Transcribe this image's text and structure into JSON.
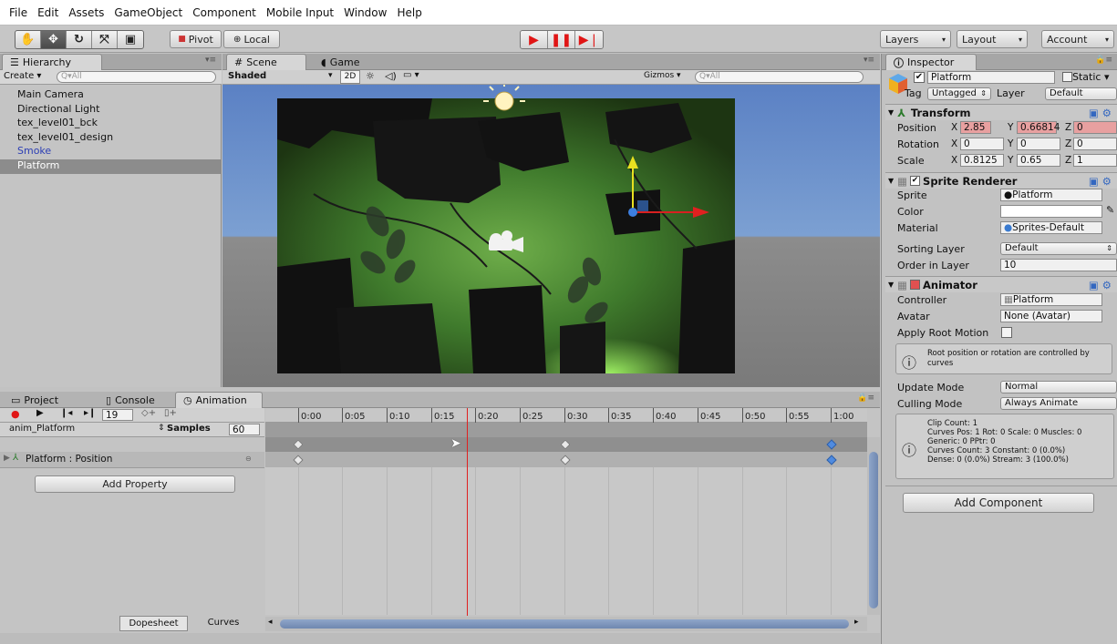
{
  "menu": [
    "File",
    "Edit",
    "Assets",
    "GameObject",
    "Component",
    "Mobile Input",
    "Window",
    "Help"
  ],
  "toolbar": {
    "tools": [
      "hand-icon",
      "move-icon",
      "rotate-icon",
      "scale-icon",
      "rect-icon"
    ],
    "pivot_label": "Pivot",
    "local_label": "Local",
    "layers_label": "Layers",
    "layout_label": "Layout",
    "account_label": "Account"
  },
  "hierarchy": {
    "tab": "Hierarchy",
    "create_label": "Create",
    "search_placeholder": "Q▾All",
    "items": [
      {
        "label": "Main Camera"
      },
      {
        "label": "Directional Light"
      },
      {
        "label": "tex_level01_bck"
      },
      {
        "label": "tex_level01_design"
      },
      {
        "label": "Smoke"
      },
      {
        "label": "Platform"
      }
    ]
  },
  "scene": {
    "tab_scene": "Scene",
    "tab_game": "Game",
    "shading": "Shaded",
    "mode_2d": "2D",
    "gizmos": "Gizmos",
    "search_placeholder": "Q▾All"
  },
  "inspector": {
    "tab": "Inspector",
    "object_name": "Platform",
    "static_label": "Static",
    "tag_label": "Tag",
    "tag_value": "Untagged",
    "layer_label": "Layer",
    "layer_value": "Default",
    "transform": {
      "title": "Transform",
      "position_label": "Position",
      "rotation_label": "Rotation",
      "scale_label": "Scale",
      "position": {
        "x": "2.85",
        "y": "0.66814",
        "z": "0"
      },
      "rotation": {
        "x": "0",
        "y": "0",
        "z": "0"
      },
      "scale": {
        "x": "0.8125",
        "y": "0.65",
        "z": "1"
      }
    },
    "sprite_renderer": {
      "title": "Sprite Renderer",
      "sprite_label": "Sprite",
      "sprite_value": "Platform",
      "color_label": "Color",
      "material_label": "Material",
      "material_value": "Sprites-Default",
      "sorting_layer_label": "Sorting Layer",
      "sorting_layer_value": "Default",
      "order_label": "Order in Layer",
      "order_value": "10"
    },
    "animator": {
      "title": "Animator",
      "controller_label": "Controller",
      "controller_value": "Platform",
      "avatar_label": "Avatar",
      "avatar_value": "None (Avatar)",
      "root_motion_label": "Apply Root Motion",
      "info": "Root position or rotation are controlled by curves",
      "update_mode_label": "Update Mode",
      "update_mode_value": "Normal",
      "culling_mode_label": "Culling Mode",
      "culling_mode_value": "Always Animate",
      "stats": [
        "Clip Count: 1",
        "Curves Pos: 1 Rot: 0 Scale: 0 Muscles: 0",
        "Generic: 0 PPtr: 0",
        "Curves Count: 3 Constant: 0 (0.0%)",
        "Dense: 0 (0.0%) Stream: 3 (100.0%)"
      ]
    },
    "add_component": "Add Component"
  },
  "bottom_tabs": {
    "project": "Project",
    "console": "Console",
    "animation": "Animation"
  },
  "animation": {
    "frame": "19",
    "clip": "anim_Platform",
    "samples_label": "Samples",
    "samples_value": "60",
    "property": "Platform : Position",
    "add_property": "Add Property",
    "dopesheet": "Dopesheet",
    "curves": "Curves",
    "ticks": [
      "0:00",
      "0:05",
      "0:10",
      "0:15",
      "0:20",
      "0:25",
      "0:30",
      "0:35",
      "0:40",
      "0:45",
      "0:50",
      "0:55",
      "1:00"
    ]
  }
}
